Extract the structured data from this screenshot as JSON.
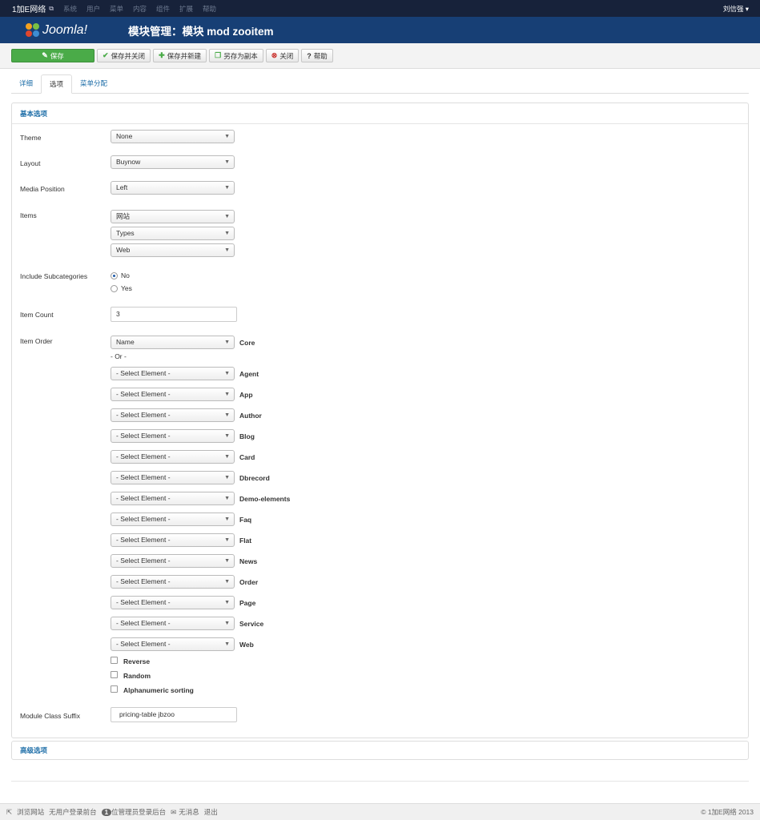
{
  "topbar": {
    "site_name": "1加E网络",
    "menu": [
      "系统",
      "用户",
      "菜单",
      "内容",
      "组件",
      "扩展",
      "帮助"
    ],
    "user": "刘信强 ▾"
  },
  "header": {
    "logo_text": "Joomla!",
    "title": "模块管理：模块 mod zooitem"
  },
  "toolbar": {
    "save": "保存",
    "save_close": "保存并关闭",
    "save_new": "保存并新建",
    "save_copy": "另存为副本",
    "close": "关闭",
    "help": "帮助"
  },
  "tabs": [
    "详细",
    "选项",
    "菜单分配"
  ],
  "basic": {
    "heading": "基本选项",
    "theme": {
      "label": "Theme",
      "value": "None"
    },
    "layout": {
      "label": "Layout",
      "value": "Buynow"
    },
    "media_position": {
      "label": "Media Position",
      "value": "Left"
    },
    "items": {
      "label": "Items",
      "values": [
        "网站",
        "Types",
        "Web"
      ]
    },
    "include_sub": {
      "label": "Include Subcategories",
      "options": [
        "No",
        "Yes"
      ],
      "selected": "No"
    },
    "item_count": {
      "label": "Item Count",
      "value": "3"
    },
    "item_order": {
      "label": "Item Order",
      "core_value": "Name",
      "core_label": "Core",
      "or_text": "- Or -",
      "element_placeholder": "- Select Element -",
      "elements": [
        "Agent",
        "App",
        "Author",
        "Blog",
        "Card",
        "Dbrecord",
        "Demo-elements",
        "Faq",
        "Flat",
        "News",
        "Order",
        "Page",
        "Service",
        "Web"
      ],
      "checkboxes": [
        "Reverse",
        "Random",
        "Alphanumeric sorting"
      ]
    },
    "suffix": {
      "label": "Module Class Suffix",
      "value": "pricing-table jbzoo"
    }
  },
  "advanced": {
    "heading": "高级选项"
  },
  "footer": {
    "view_site": "浏览网站",
    "frontend_users": "无用户登录前台",
    "admin_count": "1",
    "admin_text": "位管理员登录后台",
    "messages": "无消息",
    "logout": "退出",
    "copyright": "© 1加E网络 2013"
  }
}
